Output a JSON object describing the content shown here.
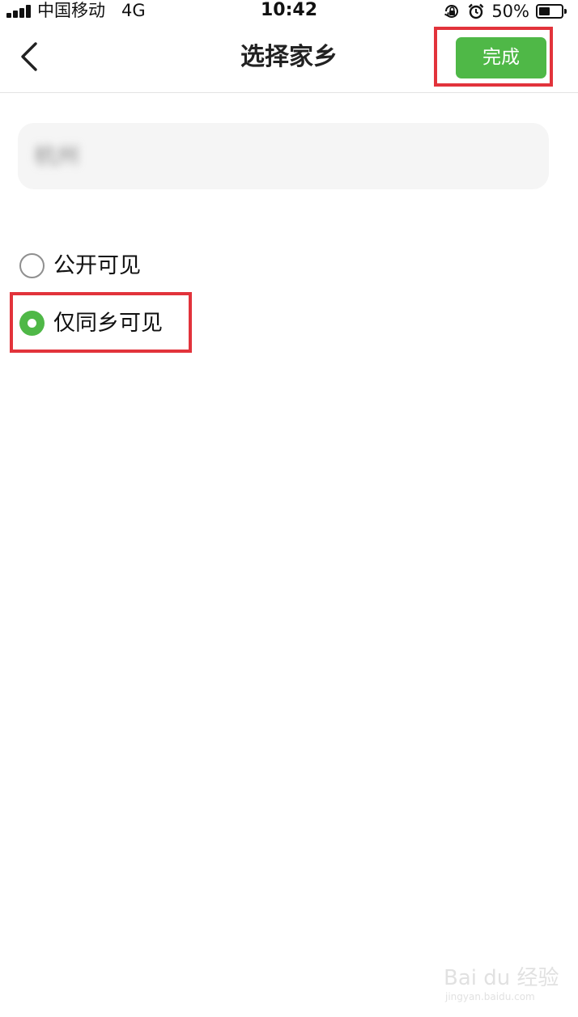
{
  "status_bar": {
    "carrier": "中国移动",
    "network": "4G",
    "time": "10:42",
    "battery_percent": "50%",
    "battery_level": 0.5,
    "icons": [
      "signal-icon",
      "rotation-lock-icon",
      "alarm-icon",
      "battery-icon"
    ]
  },
  "nav": {
    "title": "选择家乡",
    "done_label": "完成",
    "back_icon": "chevron-left-icon"
  },
  "hometown": {
    "value": "杭州"
  },
  "visibility_options": [
    {
      "label": "公开可见",
      "selected": false
    },
    {
      "label": "仅同乡可见",
      "selected": true
    }
  ],
  "colors": {
    "accent_green": "#4fb847",
    "highlight_red": "#e2333b",
    "field_background": "#f5f5f5"
  },
  "watermark": {
    "logo": "Bai du 经验",
    "url": "jingyan.baidu.com"
  }
}
